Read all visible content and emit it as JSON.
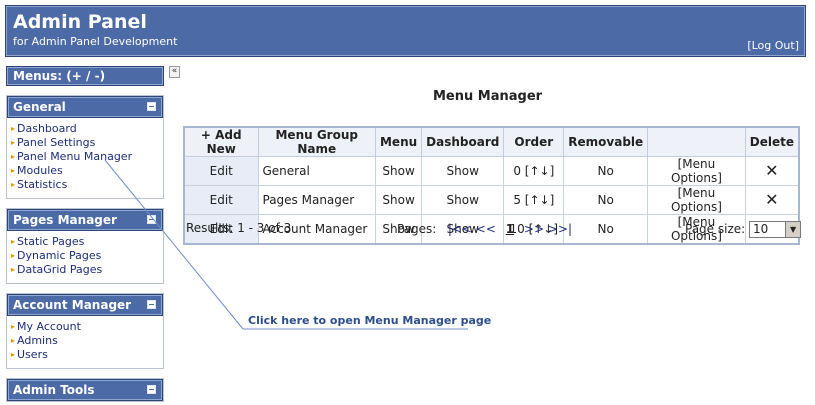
{
  "header": {
    "title": "Admin Panel",
    "subtitle": "for Admin Panel Development",
    "logout": "[Log Out]"
  },
  "sidebar": {
    "menus_label": "Menus:",
    "menus_add": "(+",
    "menus_sep": "/",
    "menus_remove": "-)",
    "collapse_toggle": "«",
    "groups": [
      {
        "title": "General",
        "items": [
          "Dashboard",
          "Panel Settings",
          "Panel Menu Manager",
          "Modules",
          "Statistics"
        ]
      },
      {
        "title": "Pages Manager",
        "items": [
          "Static Pages",
          "Dynamic Pages",
          "DataGrid Pages"
        ]
      },
      {
        "title": "Account Manager",
        "items": [
          "My Account",
          "Admins",
          "Users"
        ]
      },
      {
        "title": "Admin Tools",
        "items": []
      }
    ]
  },
  "main": {
    "title": "Menu Manager",
    "columns": [
      "+ Add New",
      "Menu Group Name",
      "Menu",
      "Dashboard",
      "Order",
      "Removable",
      "",
      "Delete"
    ],
    "rows": [
      {
        "edit": "Edit",
        "name": "General",
        "menu": "Show",
        "dashboard": "Show",
        "order": "0",
        "order_arrows": "[↑↓]",
        "removable": "No",
        "options": "[Menu Options]",
        "delete": "✕"
      },
      {
        "edit": "Edit",
        "name": "Pages Manager",
        "menu": "Show",
        "dashboard": "Show",
        "order": "5",
        "order_arrows": "[↑↓]",
        "removable": "No",
        "options": "[Menu Options]",
        "delete": "✕"
      },
      {
        "edit": "Edit",
        "name": "Account Manager",
        "menu": "Show",
        "dashboard": "Show",
        "order": "10",
        "order_arrows": "[↑↓]",
        "removable": "No",
        "options": "[Menu Options]",
        "delete": "✕"
      }
    ],
    "results": "Results: 1 - 3 of 3",
    "pager": {
      "label": "Pages:",
      "first": "|<<",
      "prev": "<<",
      "current": "1",
      "next": ">>",
      "last": ">>|"
    },
    "page_size_label": "Page size:",
    "page_size_value": "10"
  },
  "callout": {
    "text": "Click here to open Menu Manager page"
  },
  "colors": {
    "header_bg": "#4b6aa6",
    "link": "#1d2d7a",
    "callout": "#2c4e8c"
  }
}
